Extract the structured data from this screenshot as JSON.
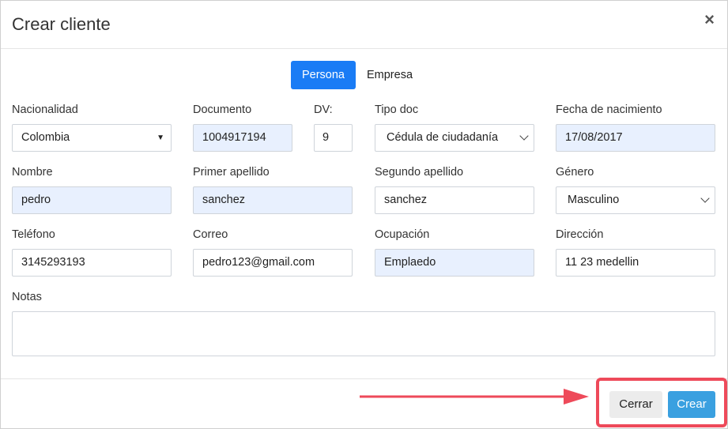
{
  "modal": {
    "title": "Crear cliente",
    "close_symbol": "×"
  },
  "tabs": {
    "persona": "Persona",
    "empresa": "Empresa",
    "active": "Persona"
  },
  "form": {
    "nacionalidad": {
      "label": "Nacionalidad",
      "value": "Colombia"
    },
    "documento": {
      "label": "Documento",
      "value": "1004917194"
    },
    "dv": {
      "label": "DV:",
      "value": "9"
    },
    "tipo_doc": {
      "label": "Tipo doc",
      "value": "Cédula de ciudadanía"
    },
    "fecha_nacimiento": {
      "label": "Fecha de nacimiento",
      "value": "17/08/2017"
    },
    "nombre": {
      "label": "Nombre",
      "value": "pedro"
    },
    "primer_apellido": {
      "label": "Primer apellido",
      "value": "sanchez"
    },
    "segundo_apellido": {
      "label": "Segundo apellido",
      "value": "sanchez"
    },
    "genero": {
      "label": "Género",
      "value": "Masculino"
    },
    "telefono": {
      "label": "Teléfono",
      "value": "3145293193"
    },
    "correo": {
      "label": "Correo",
      "value": "pedro123@gmail.com"
    },
    "ocupacion": {
      "label": "Ocupación",
      "value": "Emplaedo"
    },
    "direccion": {
      "label": "Dirección",
      "value": "11 23 medellin"
    },
    "notas": {
      "label": "Notas",
      "value": ""
    }
  },
  "footer": {
    "cerrar_label": "Cerrar",
    "crear_label": "Crear"
  },
  "colors": {
    "primary": "#1a7cf5",
    "crear_button": "#3aa0e0",
    "autofill_bg": "#e8f0fe",
    "highlight": "#ee4a5a"
  },
  "icons": {
    "close": "close-icon",
    "select_caret": "caret-down-icon",
    "select_chevron": "chevron-down-icon",
    "annotation_arrow": "arrow-right-icon"
  }
}
